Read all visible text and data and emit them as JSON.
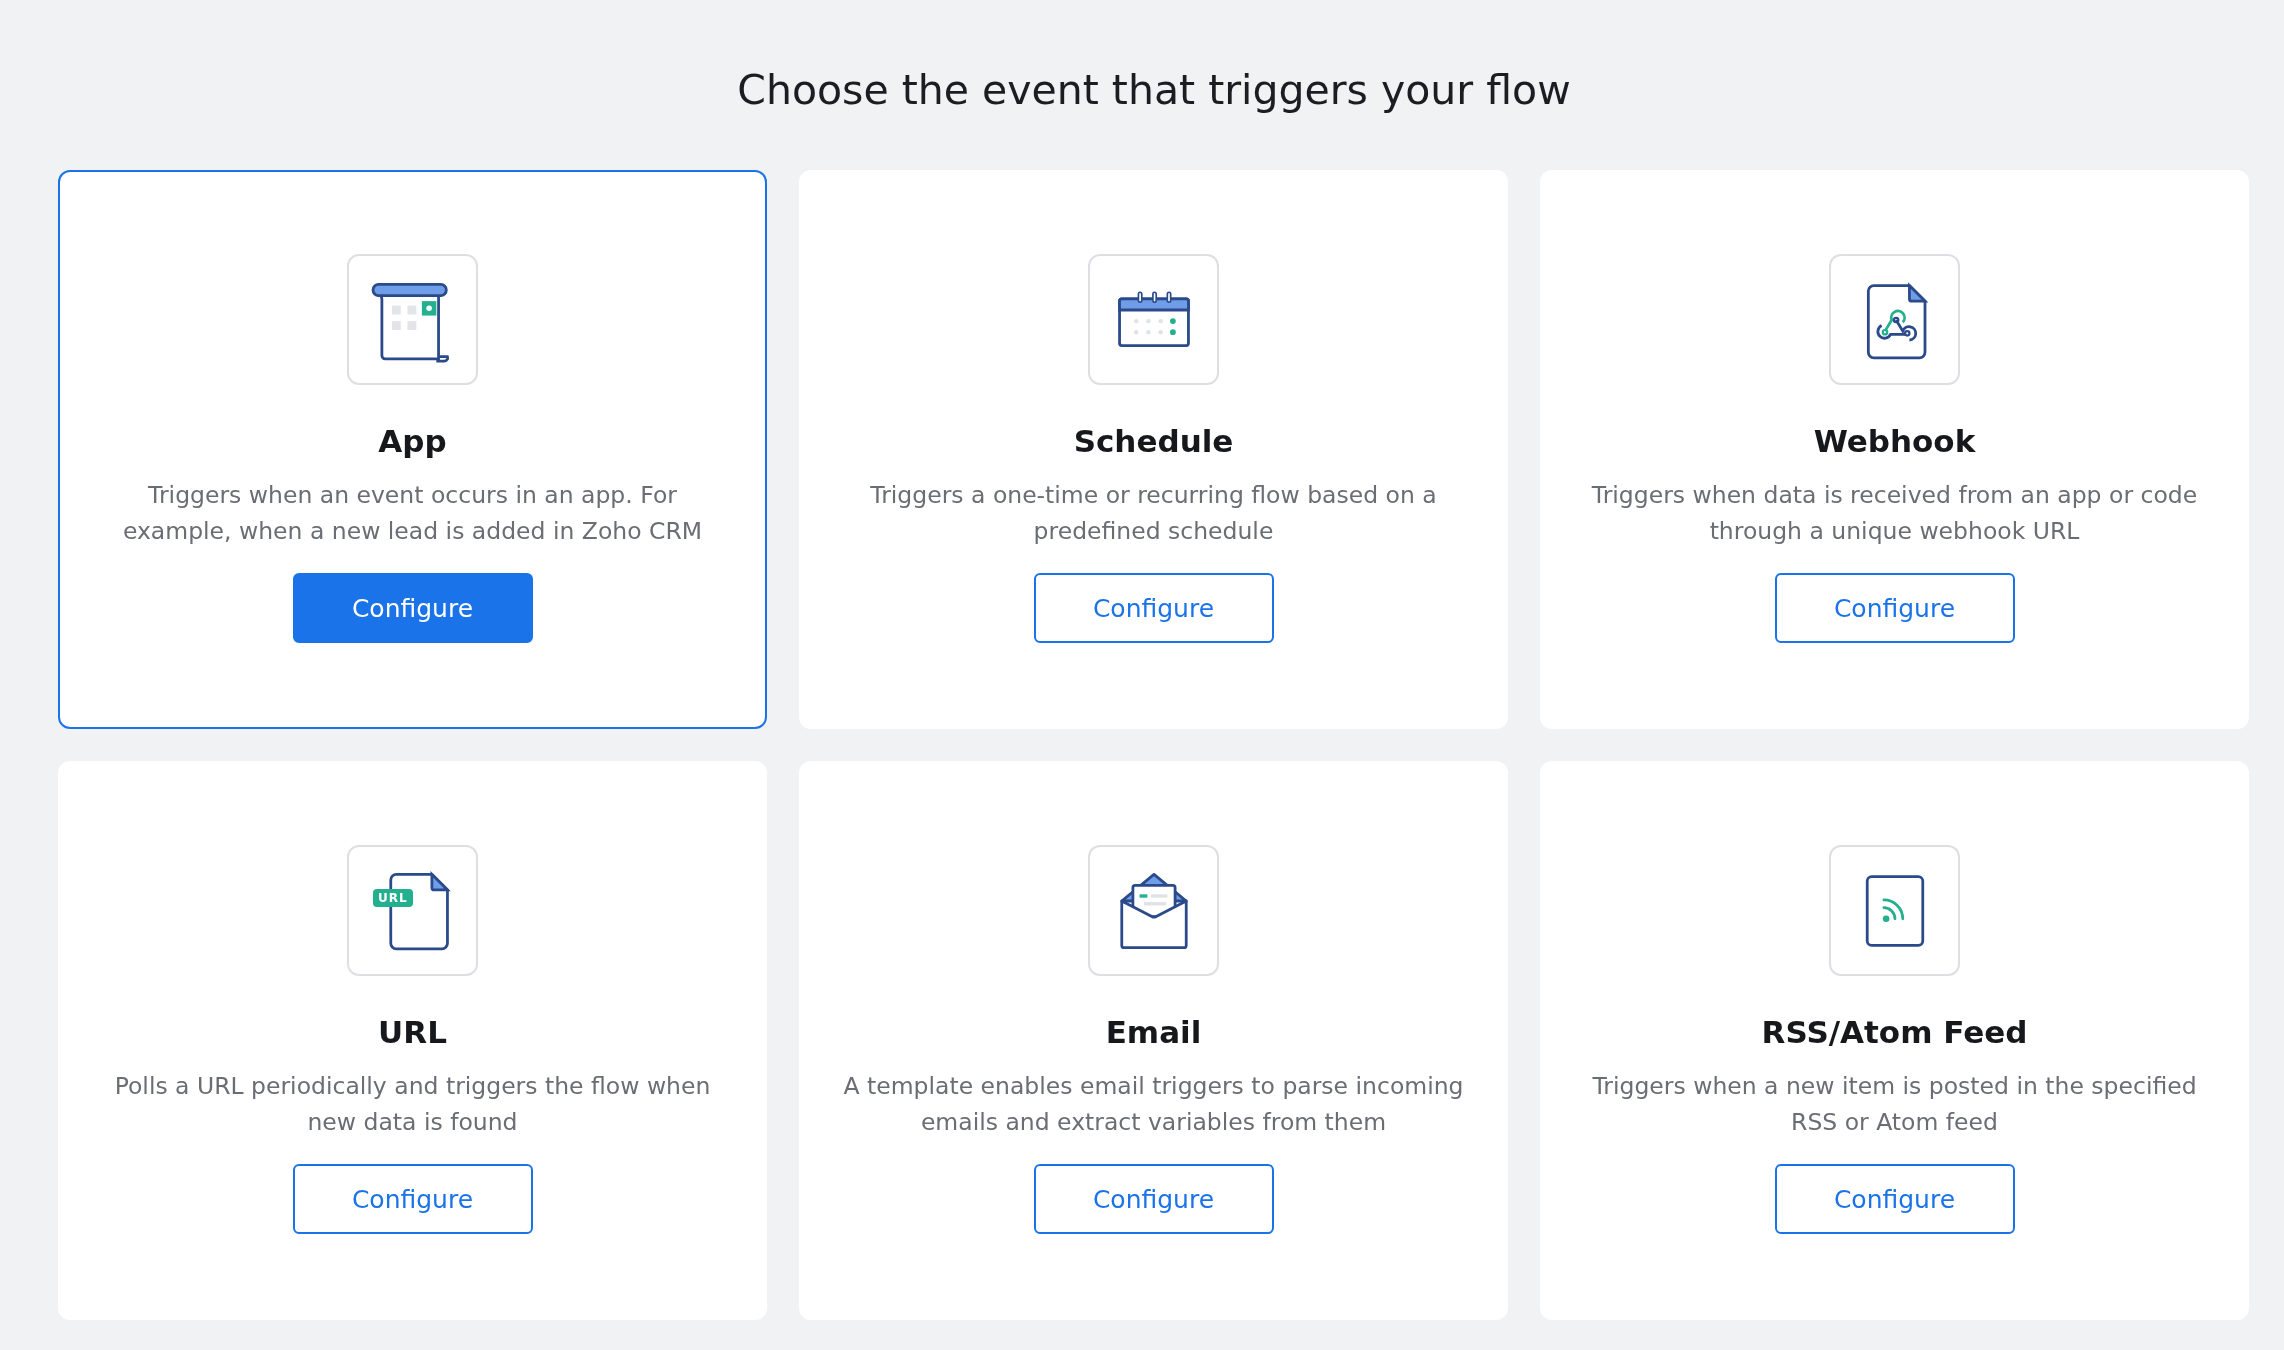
{
  "heading": "Choose the event that triggers your flow",
  "cards": [
    {
      "kind": "app",
      "title": "App",
      "description": "Triggers when an event occurs in an app. For example, when a new lead is added in Zoho CRM",
      "button": "Configure",
      "selected": true
    },
    {
      "kind": "calendar",
      "title": "Schedule",
      "description": "Triggers a one-time or recurring flow based on a predefined schedule",
      "button": "Configure",
      "selected": false
    },
    {
      "kind": "webhook",
      "title": "Webhook",
      "description": "Triggers when data is received from an app or code through a unique webhook URL",
      "button": "Configure",
      "selected": false
    },
    {
      "kind": "url",
      "icon_badge": "URL",
      "title": "URL",
      "description": "Polls a URL periodically and triggers the flow when new data is found",
      "button": "Configure",
      "selected": false
    },
    {
      "kind": "email",
      "title": "Email",
      "description": "A template enables email triggers to parse incoming emails and extract variables from them",
      "button": "Configure",
      "selected": false
    },
    {
      "kind": "rss",
      "title": "RSS/Atom Feed",
      "description": "Triggers when a new item is posted in the specified RSS or Atom feed",
      "button": "Configure",
      "selected": false
    }
  ]
}
